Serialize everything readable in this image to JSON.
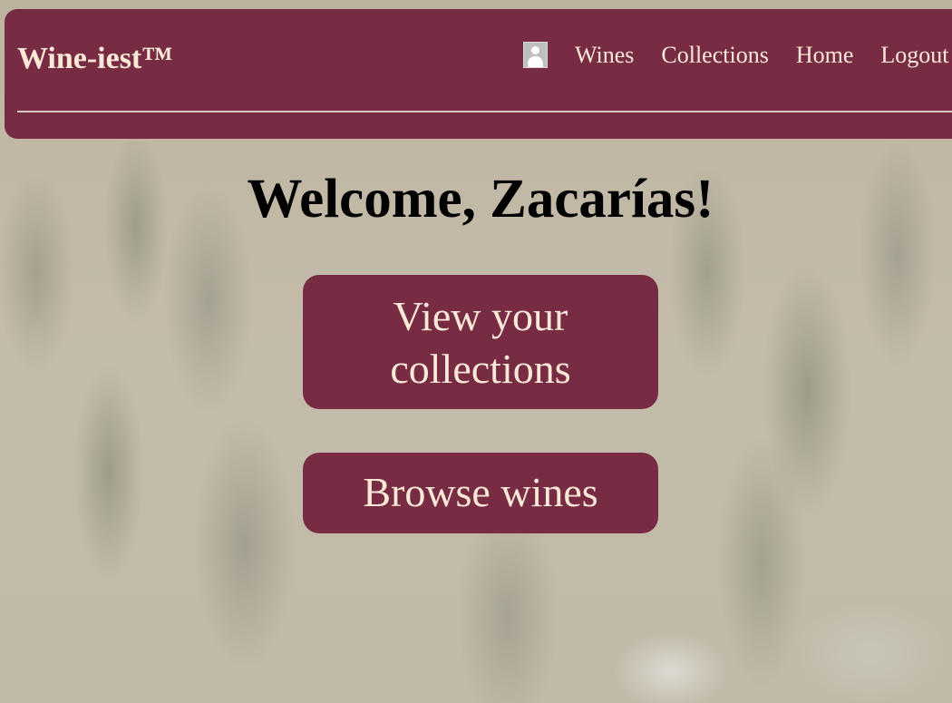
{
  "header": {
    "brand": "Wine-iest™",
    "profile_icon": "user-avatar-icon",
    "links": {
      "wines": "Wines",
      "collections": "Collections",
      "home": "Home",
      "logout": "Logout"
    }
  },
  "main": {
    "welcome": "Welcome, Zacarías!",
    "view_collections_line1": "View your",
    "view_collections_line2": "collections",
    "browse_wines": "Browse wines"
  },
  "colors": {
    "brand": "#782c44",
    "text_on_brand": "#fbe9d8",
    "background": "#bdb4a0"
  }
}
